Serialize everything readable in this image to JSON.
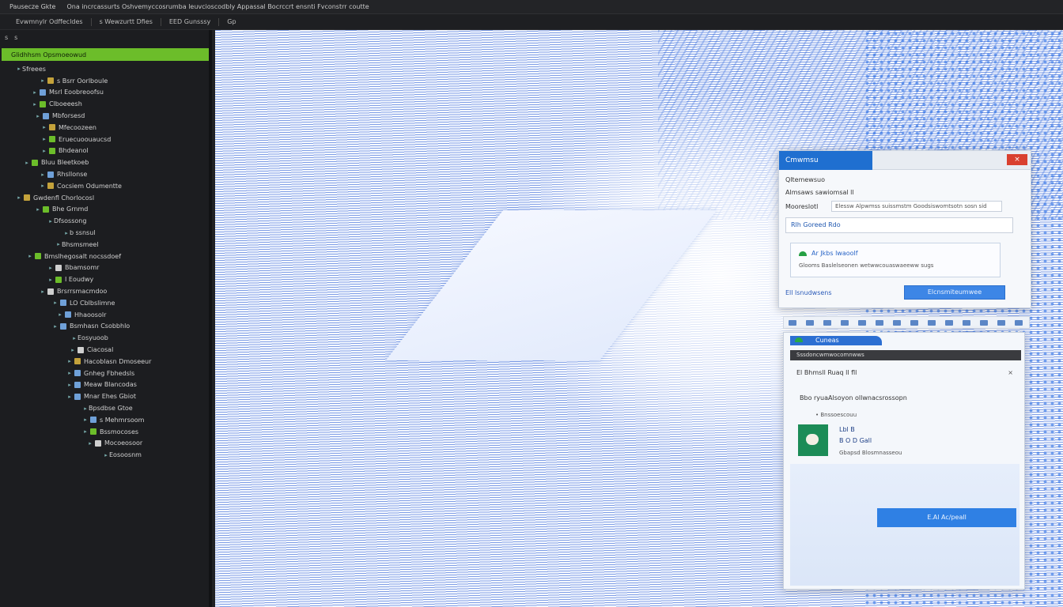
{
  "menubar": {
    "app_label": "Pausecze Gkte",
    "items": [
      "Ona incrcassurts Oshvemyccosrumba leuvcioscodbly Appassal Bocrccrt ensnti Fvconstrr coutte"
    ]
  },
  "toolbar": {
    "items": [
      "Evwmnylr Odffecldes",
      "s Wewzurtt Dfies",
      "EED Gunsssy",
      "Gp"
    ]
  },
  "tree": {
    "header": [
      "s",
      "s"
    ],
    "selected_label": "Glidhhsm Opsmoeowud",
    "rows": [
      {
        "label": "Sfreees",
        "indent": 20,
        "icon": "none"
      },
      {
        "label": "s Bsrr Oorlboule",
        "indent": 50,
        "icon": "folder"
      },
      {
        "label": "Msrl Eoobreoofsu",
        "indent": 40,
        "icon": "file"
      },
      {
        "label": "Clboeeesh",
        "indent": 40,
        "icon": "green"
      },
      {
        "label": "Mbforsesd",
        "indent": 44,
        "icon": "file"
      },
      {
        "label": "Mfecoozeen",
        "indent": 52,
        "icon": "folder"
      },
      {
        "label": "Eruecuoouaucsd",
        "indent": 52,
        "icon": "green"
      },
      {
        "label": "Bhdeanol",
        "indent": 52,
        "icon": "green"
      },
      {
        "label": "Bluu Bleetkoeb",
        "indent": 30,
        "icon": "green"
      },
      {
        "label": "Rhsllonse",
        "indent": 50,
        "icon": "file"
      },
      {
        "label": "Cocsiem Odumentte",
        "indent": 50,
        "icon": "folder"
      },
      {
        "label": "Gwdenfl Chorlocosl",
        "indent": 20,
        "icon": "folder"
      },
      {
        "label": "Bhe Grnmd",
        "indent": 44,
        "icon": "green"
      },
      {
        "label": "Dfsossong",
        "indent": 60,
        "icon": "none"
      },
      {
        "label": "b ssnsul",
        "indent": 80,
        "icon": "none"
      },
      {
        "label": "Bhsmsmeel",
        "indent": 70,
        "icon": "none"
      },
      {
        "label": "Bmslhegosalt nocssdoef",
        "indent": 34,
        "icon": "green"
      },
      {
        "label": "Bbamsomr",
        "indent": 60,
        "icon": "box"
      },
      {
        "label": "I Eoudwy",
        "indent": 60,
        "icon": "green"
      },
      {
        "label": "Brsrrsmacmdoo",
        "indent": 50,
        "icon": "box"
      },
      {
        "label": "LO Cblbslimne",
        "indent": 66,
        "icon": "file"
      },
      {
        "label": "Hhaoosolr",
        "indent": 72,
        "icon": "file"
      },
      {
        "label": "Bsmhasn Csobbhlo",
        "indent": 66,
        "icon": "file"
      },
      {
        "label": "Eosyuoob",
        "indent": 90,
        "icon": "none"
      },
      {
        "label": "Ciacosal",
        "indent": 88,
        "icon": "box"
      },
      {
        "label": "Hacoblasn Dmoseeur",
        "indent": 84,
        "icon": "folder"
      },
      {
        "label": "Gnheg Fbhedsls",
        "indent": 84,
        "icon": "file"
      },
      {
        "label": "Meaw Blancodas",
        "indent": 84,
        "icon": "file"
      },
      {
        "label": "Mnar Ehes Gbiot",
        "indent": 84,
        "icon": "file"
      },
      {
        "label": "Bpsdbse Gtoe",
        "indent": 104,
        "icon": "none"
      },
      {
        "label": "s Mehmrsoom",
        "indent": 104,
        "icon": "file"
      },
      {
        "label": "Bssmocoses",
        "indent": 104,
        "icon": "green"
      },
      {
        "label": "Mocoeosoor",
        "indent": 110,
        "icon": "box"
      },
      {
        "label": "Eosoosnm",
        "indent": 130,
        "icon": "none"
      }
    ]
  },
  "dialog": {
    "title": "Cmwmsu",
    "close": "×",
    "section": "Qltemewsuo",
    "field_label": "Almsaws sawiomsal ll",
    "field2_label": "Mooreslotl",
    "field_value": "Elessw Alpwmss suissmstm Goodsiswomtsotn sosn sid",
    "path": "Rlh Goreed Rdo",
    "card_title": "Ar Jkbs lwaoolf",
    "card_sub": "Glooms Baslelseonen wetwwcouaswaeeww sugs",
    "foot_label": "Ell lsnudwsens",
    "primary_button": "Elcnsmiteumwee"
  },
  "dialog2": {
    "tab_label": "Cuneas",
    "darkbar": "Sssdoncwmwocomnwws",
    "line1": "El Bhmsll Ruaq ll fll",
    "x": "×",
    "line2": "Bbo ryuaAlsoyon ollwnacsrossopn",
    "line3": "• Bnssoescouu",
    "app1": "Lbl B",
    "app2": "B O D Gall",
    "app3": "Gbapsd Blosmnasseou",
    "action_button": "E.Al Ac/peall"
  },
  "colors": {
    "accent_green": "#6cbd2a",
    "brand_blue": "#1f6fd0",
    "close_red": "#d9402f",
    "editor_bg": "#1c1d20"
  }
}
